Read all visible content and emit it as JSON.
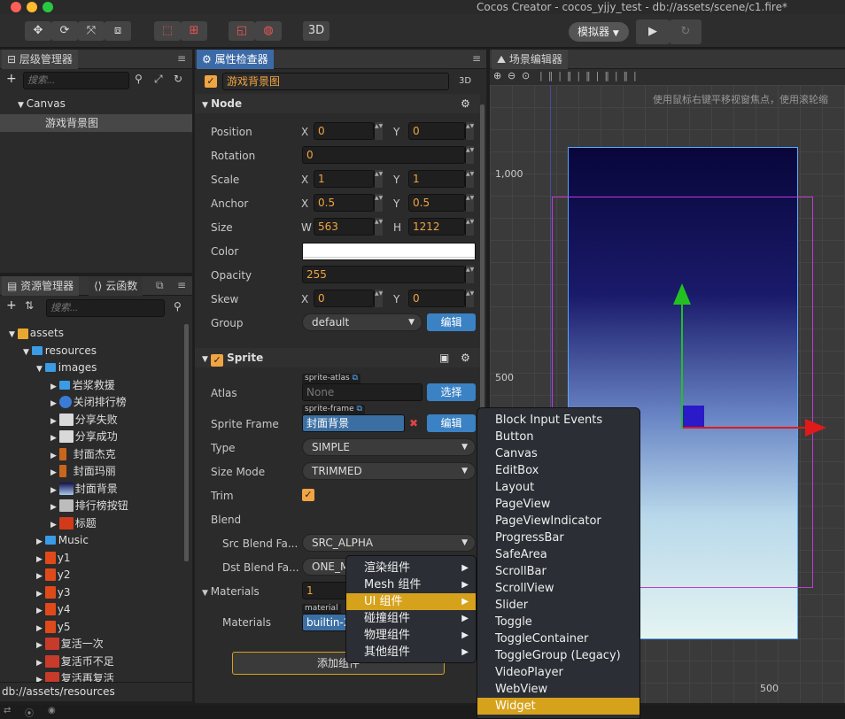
{
  "window": {
    "title": "Cocos Creator - cocos_yjjy_test - db://assets/scene/c1.fire*"
  },
  "toolbar": {
    "btn_3d": "3D",
    "simulator": "模拟器",
    "play": "▶",
    "refresh": "↻"
  },
  "hierarchy": {
    "tab": "层级管理器",
    "search_placeholder": "搜索...",
    "items": [
      {
        "label": "Canvas"
      },
      {
        "label": "游戏背景图"
      }
    ]
  },
  "assets": {
    "tab": "资源管理器",
    "tab2": "云函数",
    "search_placeholder": "搜索...",
    "items": [
      {
        "label": "assets"
      },
      {
        "label": "resources"
      },
      {
        "label": "images"
      },
      {
        "label": "岩浆救援"
      },
      {
        "label": "关闭排行榜"
      },
      {
        "label": "分享失败"
      },
      {
        "label": "分享成功"
      },
      {
        "label": "封面杰克"
      },
      {
        "label": "封面玛丽"
      },
      {
        "label": "封面背景"
      },
      {
        "label": "排行榜按钮"
      },
      {
        "label": "标题"
      },
      {
        "label": "Music"
      },
      {
        "label": "y1"
      },
      {
        "label": "y2"
      },
      {
        "label": "y3"
      },
      {
        "label": "y4"
      },
      {
        "label": "y5"
      },
      {
        "label": "复活一次"
      },
      {
        "label": "复活币不足"
      },
      {
        "label": "复活再复活"
      }
    ],
    "footer": "db://assets/resources"
  },
  "inspector": {
    "tab": "属性检查器",
    "node_name": "游戏背景图",
    "badge_3d": "3D",
    "node_section": "Node",
    "position": {
      "label": "Position",
      "x": "0",
      "y": "0"
    },
    "rotation": {
      "label": "Rotation",
      "value": "0"
    },
    "scale": {
      "label": "Scale",
      "x": "1",
      "y": "1"
    },
    "anchor": {
      "label": "Anchor",
      "x": "0.5",
      "y": "0.5"
    },
    "size": {
      "label": "Size",
      "w": "563",
      "h": "1212"
    },
    "color": {
      "label": "Color",
      "value": "#ffffff"
    },
    "opacity": {
      "label": "Opacity",
      "value": "255"
    },
    "skew": {
      "label": "Skew",
      "x": "0",
      "y": "0"
    },
    "group": {
      "label": "Group",
      "value": "default",
      "edit": "编辑"
    },
    "axis": {
      "x": "X",
      "y": "Y",
      "w": "W",
      "h": "H"
    },
    "sprite_section": "Sprite",
    "atlas": {
      "label": "Atlas",
      "tag": "sprite-atlas",
      "value": "None",
      "button": "选择"
    },
    "sprite_frame": {
      "label": "Sprite Frame",
      "tag": "sprite-frame",
      "value": "封面背景",
      "button": "编辑"
    },
    "type": {
      "label": "Type",
      "value": "SIMPLE"
    },
    "size_mode": {
      "label": "Size Mode",
      "value": "TRIMMED"
    },
    "trim": {
      "label": "Trim"
    },
    "blend": {
      "label": "Blend"
    },
    "src_blend": {
      "label": "Src Blend Fa...",
      "value": "SRC_ALPHA"
    },
    "dst_blend": {
      "label": "Dst Blend Fa...",
      "value": "ONE_M"
    },
    "materials_count": {
      "label": "Materials",
      "value": "1"
    },
    "materials": {
      "label": "Materials",
      "tag": "material",
      "value": "builtin-2"
    },
    "add_component": "添加组件"
  },
  "scene": {
    "tab": "场景编辑器",
    "hint": "使用鼠标右键平移视窗焦点，使用滚轮缩",
    "label_1000": "1,000",
    "label_500": "500",
    "label_500b": "500"
  },
  "context_menu": [
    {
      "label": "渲染组件"
    },
    {
      "label": "Mesh 组件"
    },
    {
      "label": "UI 组件"
    },
    {
      "label": "碰撞组件"
    },
    {
      "label": "物理组件"
    },
    {
      "label": "其他组件"
    }
  ],
  "submenu": [
    "Block Input Events",
    "Button",
    "Canvas",
    "EditBox",
    "Layout",
    "PageView",
    "PageViewIndicator",
    "ProgressBar",
    "SafeArea",
    "ScrollBar",
    "ScrollView",
    "Slider",
    "Toggle",
    "ToggleContainer",
    "ToggleGroup (Legacy)",
    "VideoPlayer",
    "WebView",
    "Widget"
  ]
}
